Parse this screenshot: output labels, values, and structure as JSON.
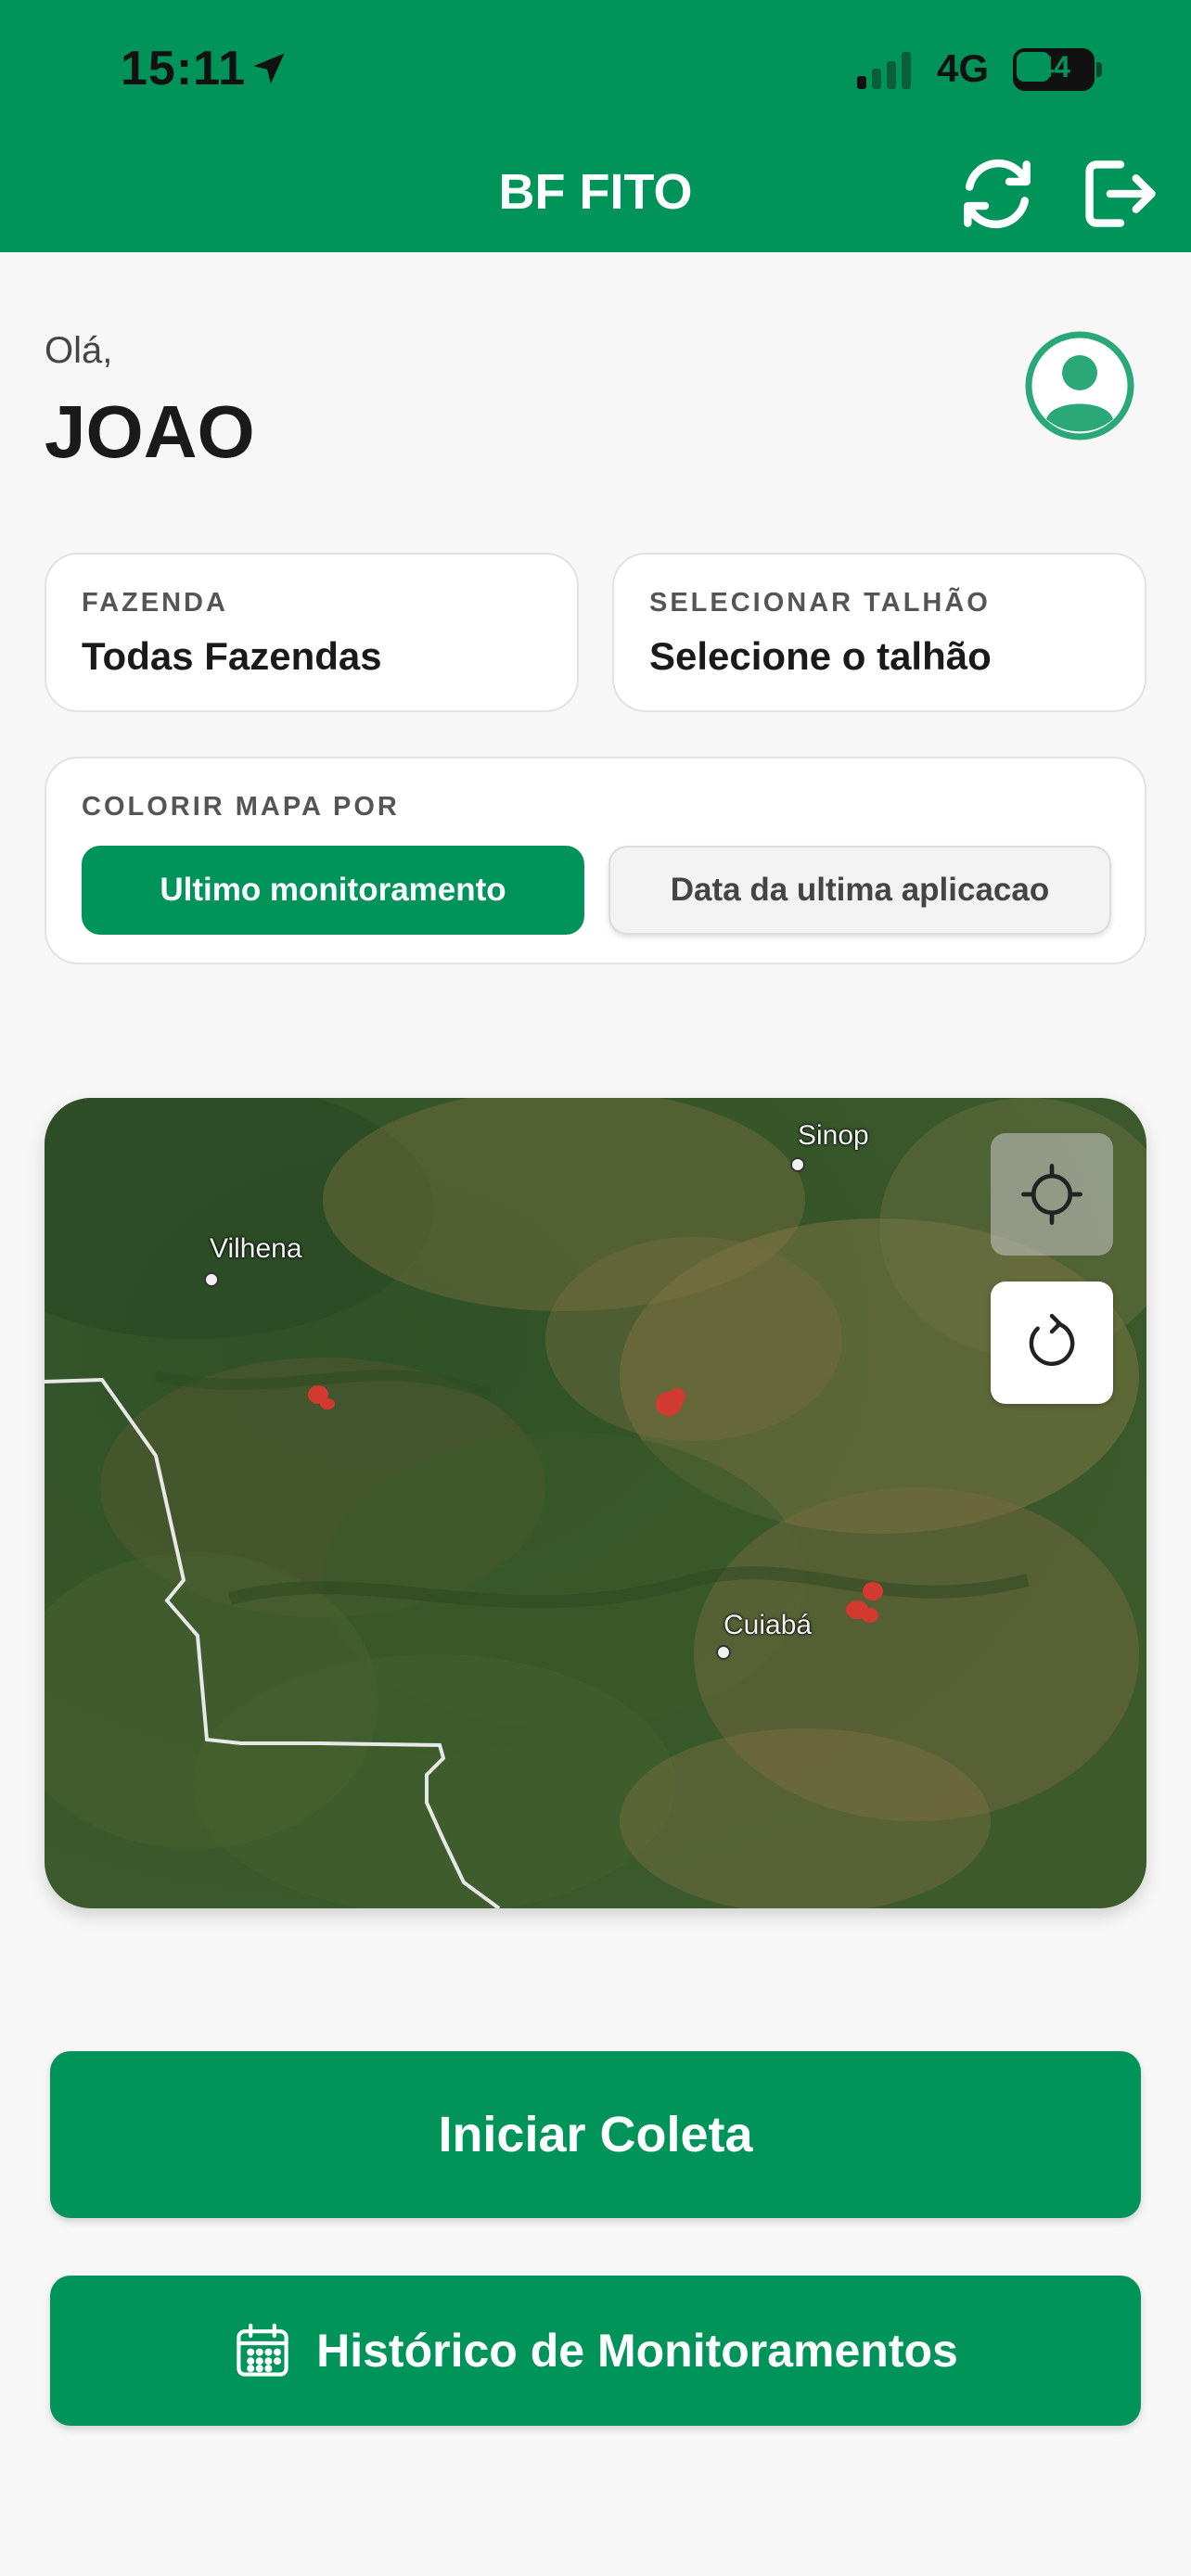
{
  "status_bar": {
    "time": "15:11",
    "network": "4G",
    "battery": "44"
  },
  "header": {
    "title": "BF FITO"
  },
  "user": {
    "greeting": "Olá,",
    "name": "JOAO"
  },
  "filters": {
    "farm": {
      "label": "FAZENDA",
      "value": "Todas Fazendas"
    },
    "plot": {
      "label": "SELECIONAR TALHÃO",
      "value": "Selecione o talhão"
    }
  },
  "color_by": {
    "label": "COLORIR MAPA POR",
    "options": [
      "Ultimo monitoramento",
      "Data da ultima aplicacao"
    ],
    "selected": "Ultimo monitoramento"
  },
  "map": {
    "labels": [
      "Sinop",
      "Vilhena",
      "Cuiabá"
    ],
    "marker_color": "#d23a30"
  },
  "actions": {
    "start": "Iniciar Coleta",
    "history": "Histórico de Monitoramentos"
  },
  "colors": {
    "primary": "#00945b",
    "background": "#f7f7f7"
  },
  "icons": {
    "sync": "sync-icon",
    "logout": "logout-icon",
    "avatar": "user-avatar-icon",
    "locate": "crosshair-icon",
    "refresh": "refresh-icon",
    "calendar": "calendar-icon"
  }
}
